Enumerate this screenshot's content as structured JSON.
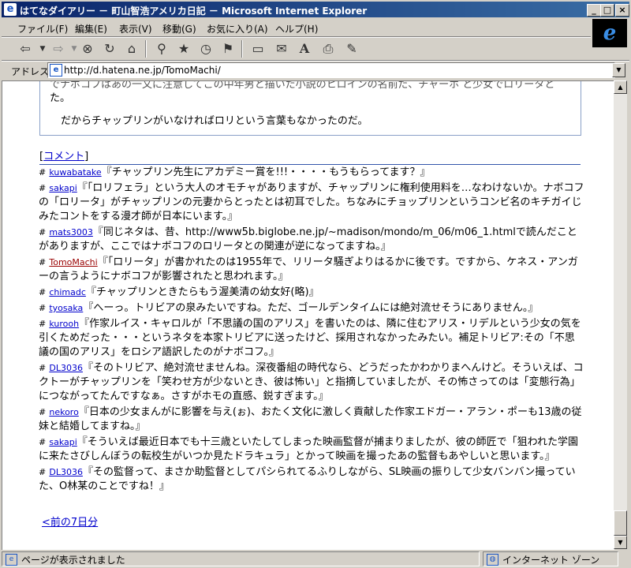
{
  "window": {
    "title": "はてなダイアリー － 町山智浩アメリカ日記 － Microsoft Internet Explorer",
    "ie_icon": "ie-logo-icon",
    "controls": [
      "_",
      "□",
      "×"
    ]
  },
  "menu": [
    "ファイル(F)",
    "編集(E)",
    "表示(V)",
    "移動(G)",
    "お気に入り(A)",
    "ヘルプ(H)"
  ],
  "toolbar": {
    "buttons": [
      "back-icon",
      "forward-icon",
      "stop-icon",
      "refresh-icon",
      "home-icon",
      "search-icon",
      "favorites-icon",
      "history-icon",
      "channels-icon",
      "fullscreen-icon",
      "mail-icon",
      "font-icon",
      "print-icon",
      "edit-icon"
    ]
  },
  "address": {
    "label": "アドレス",
    "url": "http://d.hatena.ne.jp/TomoMachi/"
  },
  "article": {
    "line_cut": "でナボコフはあの一文に注意してこの中年男と描いた小説のヒロインの名前だ、チャーホ と少女でロリータと",
    "line_end": "た。",
    "line_main": "だからチャップリンがいなければロリという言葉もなかったのだ。"
  },
  "comments_header": {
    "open": "[",
    "link": "コメント",
    "close": "]"
  },
  "comments": [
    {
      "user": "kuwabatake",
      "text": "『チャップリン先生にアカデミー賞を!!!・・・・もうもらってます？』",
      "mine": false
    },
    {
      "user": "sakapi",
      "text": "『「ロリフェラ」という大人のオモチャがありますが、チャップリンに権利使用料を…なわけないか。ナボコフの「ロリータ」がチャップリンの元妻からとったとは初耳でした。ちなみにチョップリンというコンビ名のキチガイじみたコントをする漫才師が日本にいます。』",
      "mine": false
    },
    {
      "user": "mats3003",
      "text": "『同じネタは、昔、http://www5b.biglobe.ne.jp/~madison/mondo/m_06/m06_1.htmlで読んだことがありますが、ここではナボコフのロリータとの関連が逆になってますね。』",
      "mine": false
    },
    {
      "user": "TomoMachi",
      "text": "『「ロリータ」が書かれたのは1955年で、リリータ騒ぎよりはるかに後です。ですから、ケネス・アンガーの言うようにナボコフが影響されたと思われます。』",
      "mine": true
    },
    {
      "user": "chimadc",
      "text": "『チャップリンときたらもう渥美清の幼女好(略)』",
      "mine": false
    },
    {
      "user": "tyosaka",
      "text": "『へーっ。トリビアの泉みたいですね。ただ、ゴールデンタイムには絶対流せそうにありません。』",
      "mine": false
    },
    {
      "user": "kurooh",
      "text": "『作家ルイス・キャロルが「不思議の国のアリス」を書いたのは、隣に住むアリス・リデルという少女の気を引くためだった・・・というネタを本家トリビアに送ったけど、採用されなかったみたい。補足トリビア:その「不思議の国のアリス」をロシア語訳したのがナボコフ。』",
      "mine": false
    },
    {
      "user": "DL3036",
      "text": "『そのトリビア、絶対流せませんね。深夜番組の時代なら、どうだったかわかりまへんけど。そういえば、コクトーがチャップリンを「笑わせ方が少ないとき、彼は怖い」と指摘していましたが、その怖さってのは「変態行為」につながってたんですなぁ。さすがホモの直感、鋭すぎます。』",
      "mine": false
    },
    {
      "user": "nekoro",
      "text": "『日本の少女まんがに影響を与え(ぉ)、おたく文化に激しく貢献した作家エドガー・アラン・ポーも13歳の従妹と結婚してますね。』",
      "mine": false
    },
    {
      "user": "sakapi",
      "text": "『そういえば最近日本でも十三歳といたしてしまった映画監督が捕まりましたが、彼の師匠で「狙われた学園に来たさびしんぼうの転校生がいつか見たドラキュラ」とかって映画を撮ったあの監督もあやしいと思います。』",
      "mine": false
    },
    {
      "user": "DL3036",
      "text": "『その監督って、まさか助監督としてパシられてるふりしながら、SL映画の振りして少女バンバン撮っていた、O林某のことですね！』",
      "mine": false
    }
  ],
  "prev_link": "<前の7日分",
  "status": {
    "text": "ページが表示されました",
    "zone": "インターネット ゾーン"
  }
}
